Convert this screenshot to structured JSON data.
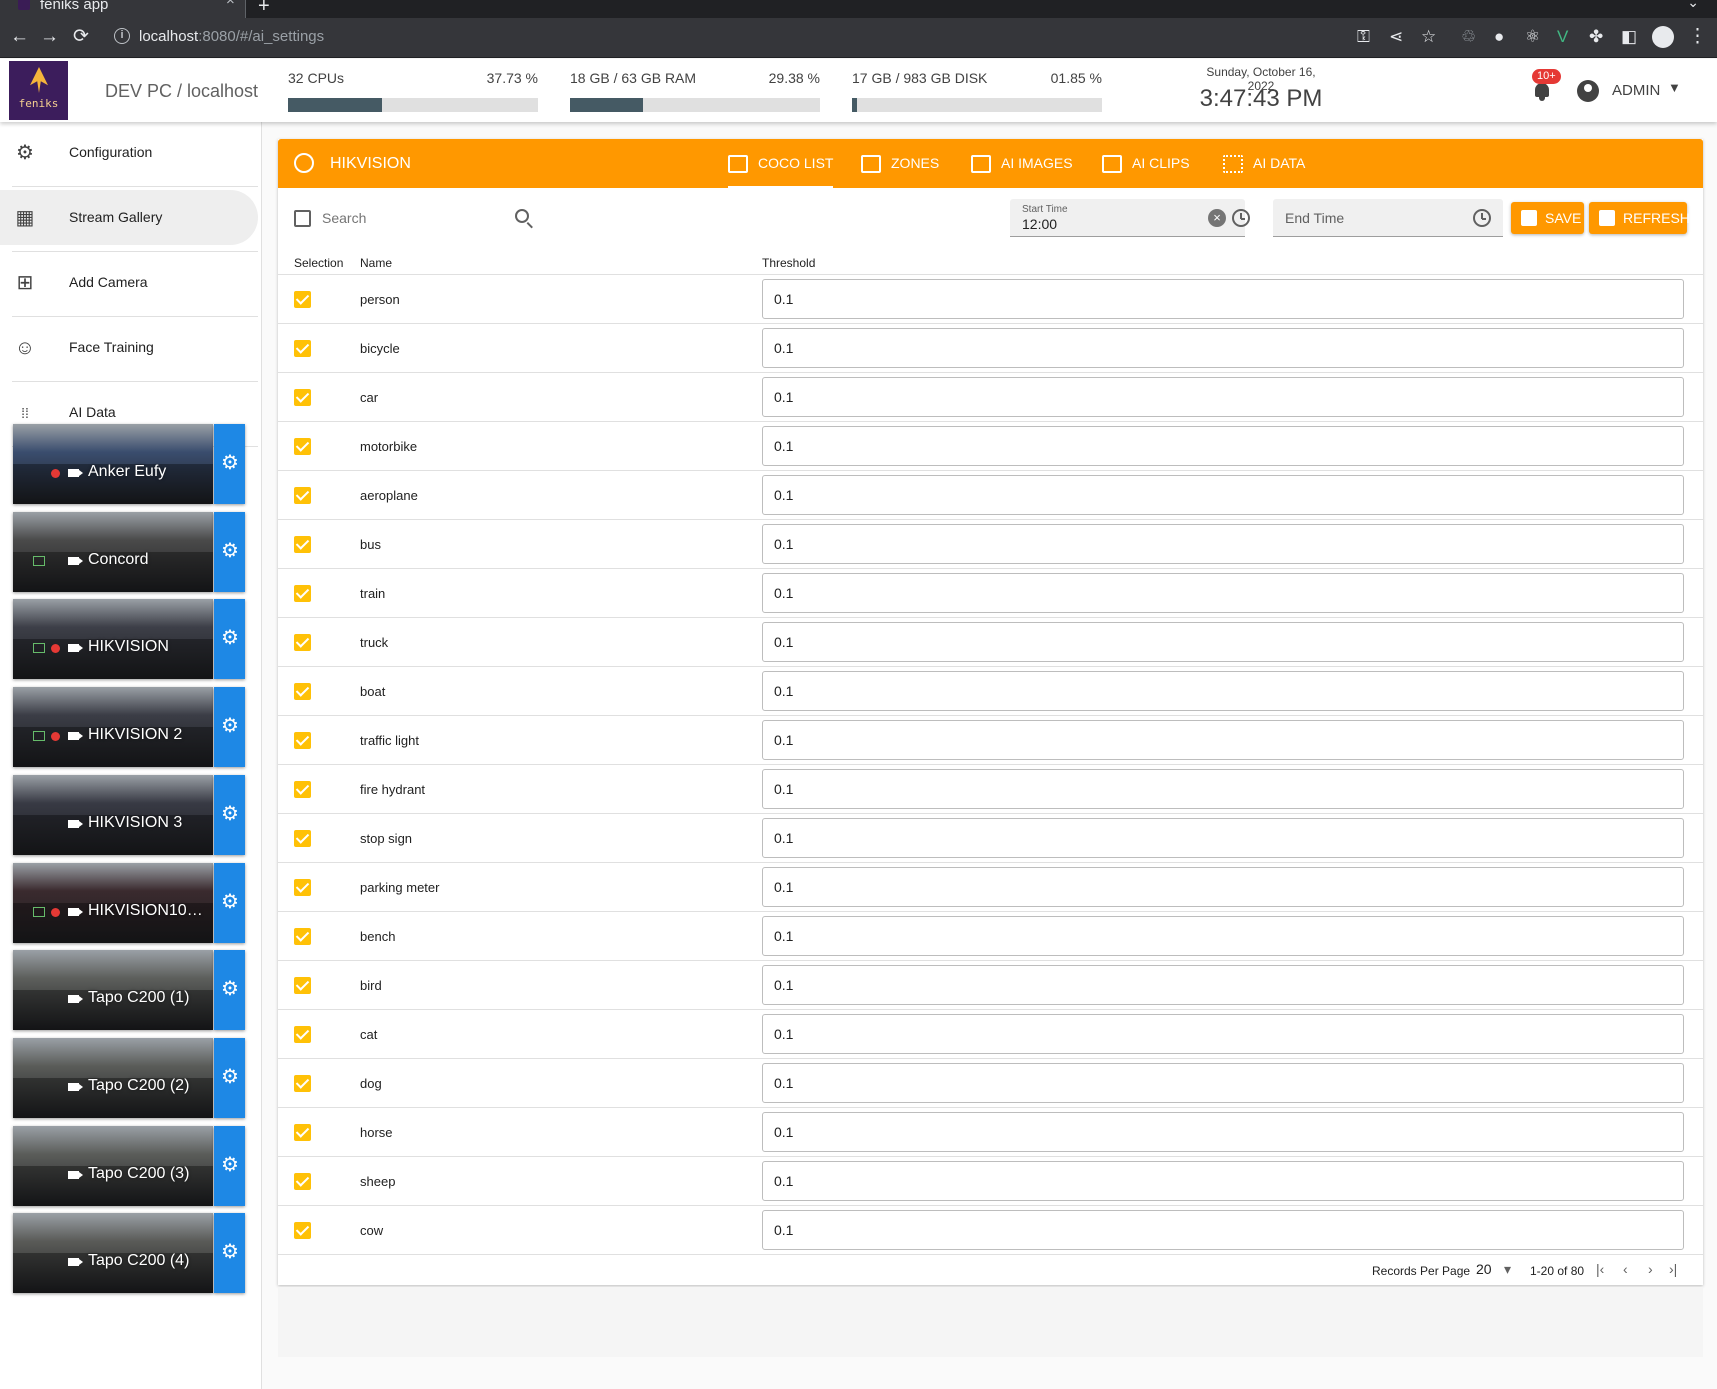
{
  "browser": {
    "tab_title": "feniks app",
    "tab_close": "×",
    "new_tab": "+",
    "tab_strip_menu": "⌄",
    "url_host": "localhost",
    "url_rest": ":8080/#/ai_settings",
    "info": "i",
    "back": "←",
    "forward": "→",
    "reload": "⟳",
    "menu": "⋮"
  },
  "header": {
    "logo_text": "feniks",
    "host": "DEV PC / localhost",
    "stats": [
      {
        "label": "32 CPUs",
        "percent_text": "37.73 %",
        "fraction": 0.3773
      },
      {
        "label": "18 GB / 63 GB RAM",
        "percent_text": "29.38 %",
        "fraction": 0.2938
      },
      {
        "label": "17 GB / 983 GB DISK",
        "percent_text": "01.85 %",
        "fraction": 0.0185
      }
    ],
    "date": "Sunday, October 16, 2022",
    "time": "3:47:43 PM",
    "notification_badge": "10+",
    "user": "ADMIN"
  },
  "sidebar": {
    "items": [
      {
        "label": "Configuration",
        "icon": "gear-icon",
        "glyph": "⚙"
      },
      {
        "label": "Stream Gallery",
        "icon": "grid-icon",
        "glyph": "▦"
      },
      {
        "label": "Add Camera",
        "icon": "add-box-icon",
        "glyph": "⊞"
      },
      {
        "label": "Face Training",
        "icon": "face-icon",
        "glyph": "☺"
      },
      {
        "label": "AI Data",
        "icon": "dots-grid-icon",
        "glyph": "⁞⁞"
      }
    ],
    "cameras": [
      {
        "name": "Anker Eufy",
        "rec": true,
        "play": false,
        "bg": "#3a4d6e"
      },
      {
        "name": "Concord",
        "rec": false,
        "play": true,
        "bg": "#4a4a4a"
      },
      {
        "name": "HIKVISION",
        "rec": true,
        "play": true,
        "bg": "#3d3f48"
      },
      {
        "name": "HIKVISION 2",
        "rec": true,
        "play": true,
        "bg": "#3b3d46"
      },
      {
        "name": "HIKVISION 3",
        "rec": false,
        "play": false,
        "bg": "#383a44"
      },
      {
        "name": "HIKVISION10…",
        "rec": true,
        "play": true,
        "bg": "#3a2a2e"
      },
      {
        "name": "Tapo C200 (1)",
        "rec": false,
        "play": false,
        "bg": "#5d5f5c"
      },
      {
        "name": "Tapo C200 (2)",
        "rec": false,
        "play": false,
        "bg": "#5a5c59"
      },
      {
        "name": "Tapo C200 (3)",
        "rec": false,
        "play": false,
        "bg": "#5b5d5a"
      },
      {
        "name": "Tapo C200 (4)",
        "rec": false,
        "play": false,
        "bg": "#5a5b58"
      }
    ]
  },
  "toolbar": {
    "camera": "HIKVISION",
    "tabs": [
      "COCO LIST",
      "ZONES",
      "AI IMAGES",
      "AI CLIPS",
      "AI DATA"
    ],
    "active_tab": "COCO LIST"
  },
  "filters": {
    "search_placeholder": "Search",
    "start_time_label": "Start Time",
    "start_time_value": "12:00",
    "end_time_placeholder": "End Time",
    "clear_glyph": "×",
    "save": "SAVE",
    "refresh": "REFRESH"
  },
  "table": {
    "headers": {
      "selection": "Selection",
      "name": "Name",
      "threshold": "Threshold"
    },
    "rows": [
      {
        "name": "person",
        "threshold": "0.1",
        "selected": true
      },
      {
        "name": "bicycle",
        "threshold": "0.1",
        "selected": true
      },
      {
        "name": "car",
        "threshold": "0.1",
        "selected": true
      },
      {
        "name": "motorbike",
        "threshold": "0.1",
        "selected": true
      },
      {
        "name": "aeroplane",
        "threshold": "0.1",
        "selected": true
      },
      {
        "name": "bus",
        "threshold": "0.1",
        "selected": true
      },
      {
        "name": "train",
        "threshold": "0.1",
        "selected": true
      },
      {
        "name": "truck",
        "threshold": "0.1",
        "selected": true
      },
      {
        "name": "boat",
        "threshold": "0.1",
        "selected": true
      },
      {
        "name": "traffic light",
        "threshold": "0.1",
        "selected": true
      },
      {
        "name": "fire hydrant",
        "threshold": "0.1",
        "selected": true
      },
      {
        "name": "stop sign",
        "threshold": "0.1",
        "selected": true
      },
      {
        "name": "parking meter",
        "threshold": "0.1",
        "selected": true
      },
      {
        "name": "bench",
        "threshold": "0.1",
        "selected": true
      },
      {
        "name": "bird",
        "threshold": "0.1",
        "selected": true
      },
      {
        "name": "cat",
        "threshold": "0.1",
        "selected": true
      },
      {
        "name": "dog",
        "threshold": "0.1",
        "selected": true
      },
      {
        "name": "horse",
        "threshold": "0.1",
        "selected": true
      },
      {
        "name": "sheep",
        "threshold": "0.1",
        "selected": true
      },
      {
        "name": "cow",
        "threshold": "0.1",
        "selected": true
      }
    ],
    "footer": {
      "records_per_page_label": "Records Per Page",
      "records_per_page": "20",
      "dropdown_glyph": "▾",
      "range": "1-20 of 80",
      "first": "|‹",
      "prev": "‹",
      "next": "›",
      "last": "›|"
    }
  },
  "colors": {
    "accent": "#ff9800",
    "checkbox": "#ffc107",
    "camera_gear": "#1e88e5",
    "badge": "#e53935"
  }
}
